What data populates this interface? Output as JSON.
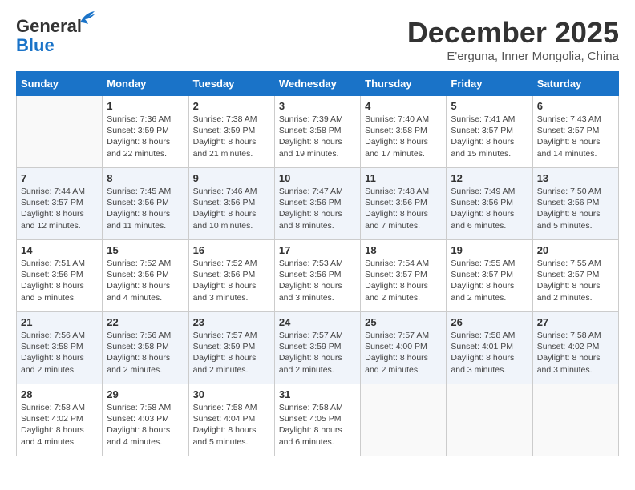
{
  "header": {
    "logo_line1": "General",
    "logo_line2": "Blue",
    "month": "December 2025",
    "location": "E'erguna, Inner Mongolia, China"
  },
  "days_of_week": [
    "Sunday",
    "Monday",
    "Tuesday",
    "Wednesday",
    "Thursday",
    "Friday",
    "Saturday"
  ],
  "weeks": [
    [
      {
        "num": "",
        "sunrise": "",
        "sunset": "",
        "daylight": ""
      },
      {
        "num": "1",
        "sunrise": "Sunrise: 7:36 AM",
        "sunset": "Sunset: 3:59 PM",
        "daylight": "Daylight: 8 hours and 22 minutes."
      },
      {
        "num": "2",
        "sunrise": "Sunrise: 7:38 AM",
        "sunset": "Sunset: 3:59 PM",
        "daylight": "Daylight: 8 hours and 21 minutes."
      },
      {
        "num": "3",
        "sunrise": "Sunrise: 7:39 AM",
        "sunset": "Sunset: 3:58 PM",
        "daylight": "Daylight: 8 hours and 19 minutes."
      },
      {
        "num": "4",
        "sunrise": "Sunrise: 7:40 AM",
        "sunset": "Sunset: 3:58 PM",
        "daylight": "Daylight: 8 hours and 17 minutes."
      },
      {
        "num": "5",
        "sunrise": "Sunrise: 7:41 AM",
        "sunset": "Sunset: 3:57 PM",
        "daylight": "Daylight: 8 hours and 15 minutes."
      },
      {
        "num": "6",
        "sunrise": "Sunrise: 7:43 AM",
        "sunset": "Sunset: 3:57 PM",
        "daylight": "Daylight: 8 hours and 14 minutes."
      }
    ],
    [
      {
        "num": "7",
        "sunrise": "Sunrise: 7:44 AM",
        "sunset": "Sunset: 3:57 PM",
        "daylight": "Daylight: 8 hours and 12 minutes."
      },
      {
        "num": "8",
        "sunrise": "Sunrise: 7:45 AM",
        "sunset": "Sunset: 3:56 PM",
        "daylight": "Daylight: 8 hours and 11 minutes."
      },
      {
        "num": "9",
        "sunrise": "Sunrise: 7:46 AM",
        "sunset": "Sunset: 3:56 PM",
        "daylight": "Daylight: 8 hours and 10 minutes."
      },
      {
        "num": "10",
        "sunrise": "Sunrise: 7:47 AM",
        "sunset": "Sunset: 3:56 PM",
        "daylight": "Daylight: 8 hours and 8 minutes."
      },
      {
        "num": "11",
        "sunrise": "Sunrise: 7:48 AM",
        "sunset": "Sunset: 3:56 PM",
        "daylight": "Daylight: 8 hours and 7 minutes."
      },
      {
        "num": "12",
        "sunrise": "Sunrise: 7:49 AM",
        "sunset": "Sunset: 3:56 PM",
        "daylight": "Daylight: 8 hours and 6 minutes."
      },
      {
        "num": "13",
        "sunrise": "Sunrise: 7:50 AM",
        "sunset": "Sunset: 3:56 PM",
        "daylight": "Daylight: 8 hours and 5 minutes."
      }
    ],
    [
      {
        "num": "14",
        "sunrise": "Sunrise: 7:51 AM",
        "sunset": "Sunset: 3:56 PM",
        "daylight": "Daylight: 8 hours and 5 minutes."
      },
      {
        "num": "15",
        "sunrise": "Sunrise: 7:52 AM",
        "sunset": "Sunset: 3:56 PM",
        "daylight": "Daylight: 8 hours and 4 minutes."
      },
      {
        "num": "16",
        "sunrise": "Sunrise: 7:52 AM",
        "sunset": "Sunset: 3:56 PM",
        "daylight": "Daylight: 8 hours and 3 minutes."
      },
      {
        "num": "17",
        "sunrise": "Sunrise: 7:53 AM",
        "sunset": "Sunset: 3:56 PM",
        "daylight": "Daylight: 8 hours and 3 minutes."
      },
      {
        "num": "18",
        "sunrise": "Sunrise: 7:54 AM",
        "sunset": "Sunset: 3:57 PM",
        "daylight": "Daylight: 8 hours and 2 minutes."
      },
      {
        "num": "19",
        "sunrise": "Sunrise: 7:55 AM",
        "sunset": "Sunset: 3:57 PM",
        "daylight": "Daylight: 8 hours and 2 minutes."
      },
      {
        "num": "20",
        "sunrise": "Sunrise: 7:55 AM",
        "sunset": "Sunset: 3:57 PM",
        "daylight": "Daylight: 8 hours and 2 minutes."
      }
    ],
    [
      {
        "num": "21",
        "sunrise": "Sunrise: 7:56 AM",
        "sunset": "Sunset: 3:58 PM",
        "daylight": "Daylight: 8 hours and 2 minutes."
      },
      {
        "num": "22",
        "sunrise": "Sunrise: 7:56 AM",
        "sunset": "Sunset: 3:58 PM",
        "daylight": "Daylight: 8 hours and 2 minutes."
      },
      {
        "num": "23",
        "sunrise": "Sunrise: 7:57 AM",
        "sunset": "Sunset: 3:59 PM",
        "daylight": "Daylight: 8 hours and 2 minutes."
      },
      {
        "num": "24",
        "sunrise": "Sunrise: 7:57 AM",
        "sunset": "Sunset: 3:59 PM",
        "daylight": "Daylight: 8 hours and 2 minutes."
      },
      {
        "num": "25",
        "sunrise": "Sunrise: 7:57 AM",
        "sunset": "Sunset: 4:00 PM",
        "daylight": "Daylight: 8 hours and 2 minutes."
      },
      {
        "num": "26",
        "sunrise": "Sunrise: 7:58 AM",
        "sunset": "Sunset: 4:01 PM",
        "daylight": "Daylight: 8 hours and 3 minutes."
      },
      {
        "num": "27",
        "sunrise": "Sunrise: 7:58 AM",
        "sunset": "Sunset: 4:02 PM",
        "daylight": "Daylight: 8 hours and 3 minutes."
      }
    ],
    [
      {
        "num": "28",
        "sunrise": "Sunrise: 7:58 AM",
        "sunset": "Sunset: 4:02 PM",
        "daylight": "Daylight: 8 hours and 4 minutes."
      },
      {
        "num": "29",
        "sunrise": "Sunrise: 7:58 AM",
        "sunset": "Sunset: 4:03 PM",
        "daylight": "Daylight: 8 hours and 4 minutes."
      },
      {
        "num": "30",
        "sunrise": "Sunrise: 7:58 AM",
        "sunset": "Sunset: 4:04 PM",
        "daylight": "Daylight: 8 hours and 5 minutes."
      },
      {
        "num": "31",
        "sunrise": "Sunrise: 7:58 AM",
        "sunset": "Sunset: 4:05 PM",
        "daylight": "Daylight: 8 hours and 6 minutes."
      },
      {
        "num": "",
        "sunrise": "",
        "sunset": "",
        "daylight": ""
      },
      {
        "num": "",
        "sunrise": "",
        "sunset": "",
        "daylight": ""
      },
      {
        "num": "",
        "sunrise": "",
        "sunset": "",
        "daylight": ""
      }
    ]
  ]
}
